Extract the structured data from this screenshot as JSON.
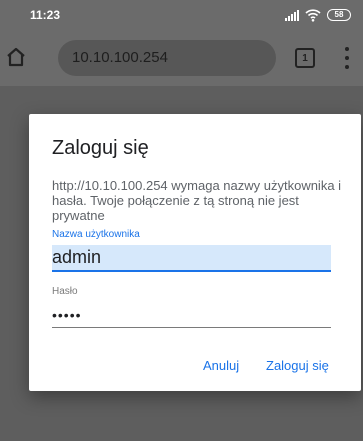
{
  "status_bar": {
    "time": "11:23",
    "battery_level": "58",
    "icons": [
      "signal-icon",
      "wifi-icon",
      "battery-icon"
    ]
  },
  "toolbar": {
    "url": "10.10.100.254",
    "tab_count": "1",
    "icons": [
      "home-icon",
      "tabs-icon",
      "more-vert-icon"
    ]
  },
  "dialog": {
    "title": "Zaloguj się",
    "message": "http://10.10.100.254 wymaga nazwy użytkownika i hasła. Twoje połączenie z tą stroną nie jest prywatne",
    "username_label": "Nazwa użytkownika",
    "username_value": "admin",
    "password_label": "Hasło",
    "password_value": "•••••",
    "cancel_label": "Anuluj",
    "login_label": "Zaloguj się"
  },
  "colors": {
    "accent": "#1a73e8",
    "dim_overlay": "#5e5e5e",
    "input_highlight": "#d6e8fb"
  }
}
